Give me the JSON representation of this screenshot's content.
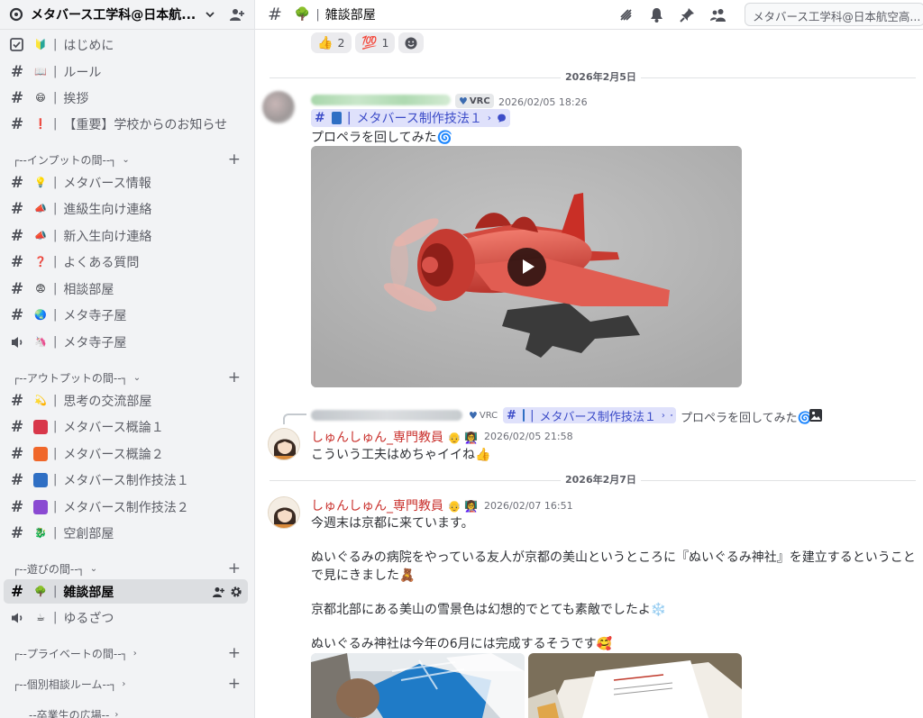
{
  "server": {
    "name": "メタバース工学科@日本航..."
  },
  "sidebar": {
    "channels_top": [
      {
        "icon": "rules-check-icon",
        "emoji": "🔰",
        "label": "はじめに"
      },
      {
        "icon": "hash",
        "emoji": "📖",
        "label": "ルール"
      },
      {
        "icon": "hash",
        "emoji": "😄",
        "label": "挨拶"
      },
      {
        "icon": "hash-thread",
        "emoji": "❗",
        "label": "【重要】学校からのお知らせ"
      }
    ],
    "categories": [
      {
        "label": "┌--インプットの間--┐",
        "chevron": "⌄"
      },
      {
        "label": "┌--アウトプットの間--┐",
        "chevron": "⌄"
      },
      {
        "label": "┌--遊びの間--┐",
        "chevron": "⌄"
      },
      {
        "label": "┌--プライベートの間--┐",
        "chevron": "›"
      },
      {
        "label": "┌--個別相談ルーム--┐",
        "chevron": "›"
      },
      {
        "label": "--卒業生の広場--",
        "chevron": "›"
      }
    ],
    "input_channels": [
      {
        "emoji": "💡",
        "label": "メタバース情報"
      },
      {
        "emoji": "📣",
        "label": "進級生向け連絡"
      },
      {
        "emoji": "📣",
        "label": "新入生向け連絡"
      },
      {
        "emoji": "❓",
        "label": "よくある質問"
      },
      {
        "emoji": "😨",
        "label": "相談部屋"
      },
      {
        "emoji": "🌏",
        "label": "メタ寺子屋"
      },
      {
        "emoji": "🦄",
        "label": "メタ寺子屋"
      }
    ],
    "output_channels": [
      {
        "emoji": "💫",
        "label": "思考の交流部屋"
      },
      {
        "color": "#d8374a",
        "label": "メタバース概論１"
      },
      {
        "color": "#f0672a",
        "label": "メタバース概論２"
      },
      {
        "color": "#2f6fc4",
        "label": "メタバース制作技法１"
      },
      {
        "color": "#8a4ad2",
        "label": "メタバース制作技法２"
      },
      {
        "emoji": "🐉",
        "label": "空創部屋"
      }
    ],
    "play_channels": [
      {
        "emoji": "🌳",
        "label": "雑談部屋",
        "selected": true
      },
      {
        "emoji": "☕",
        "label": "ゆるざつ"
      }
    ],
    "separator": "|",
    "plus": "+"
  },
  "header": {
    "hash": "#",
    "emoji": "🌳",
    "separator": "|",
    "title": "雑談部屋",
    "search_placeholder": "メタバース工学科@日本航空高..."
  },
  "reactions": [
    {
      "emoji": "👍",
      "count": "2"
    },
    {
      "emoji": "💯",
      "count": "1"
    }
  ],
  "dividers": [
    "2026年2月5日",
    "2026年2月7日"
  ],
  "messages": [
    {
      "author_hidden": true,
      "badge": "VRC",
      "timestamp": "2026/02/05 18:26",
      "channel_mention": {
        "hash": "#",
        "sep": "|",
        "label": "メタバース制作技法１",
        "arrow": "›"
      },
      "text": "プロペラを回してみた",
      "emoji": "🌀",
      "attachment": "video"
    },
    {
      "reply_to": {
        "badge": "VRC",
        "mention_label": "メタバース制作技法１",
        "text": "プロペラを回してみた",
        "emoji": "🌀"
      },
      "author": "しゅんしゅん_専門教員",
      "author_emojis": "👴 👩‍🏫",
      "timestamp": "2026/02/05 21:58",
      "text": "こういう工夫はめちゃイイね",
      "emoji": "👍"
    },
    {
      "author": "しゅんしゅん_専門教員",
      "author_emojis": "👴 👩‍🏫",
      "timestamp": "2026/02/07 16:51",
      "lines": [
        "今週末は京都に来ています。",
        "ぬいぐるみの病院をやっている友人が京都の美山というところに『ぬいぐるみ神社』を建立するということ",
        "で見にきました🧸",
        "京都北部にある美山の雪景色は幻想的でとても素敵でしたよ❄️",
        "ぬいぐるみ神社は今年の6月には完成するそうです🥰"
      ]
    }
  ],
  "colors": {
    "sidebar_bg": "#f2f3f5",
    "selected_bg": "#dcdee1",
    "mention_bg": "#dfe1fb",
    "mention_text": "#3c4cc8",
    "author_red": "#c9302c"
  }
}
